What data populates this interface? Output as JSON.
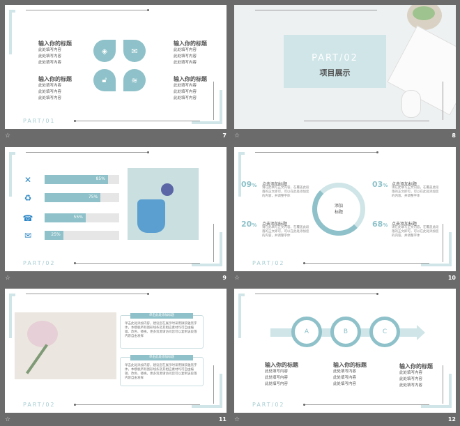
{
  "slides": {
    "s7": {
      "part": "PART/01",
      "num": "7",
      "left": [
        {
          "title": "输入你的标题",
          "lines": [
            "此处填写内容",
            "此处填写内容",
            "此处填写内容"
          ]
        },
        {
          "title": "输入你的标题",
          "lines": [
            "此处填写内容",
            "此处填写内容",
            "此处填写内容"
          ]
        }
      ],
      "right": [
        {
          "title": "输入你的标题",
          "lines": [
            "此处填写内容",
            "此处填写内容",
            "此处填写内容"
          ]
        },
        {
          "title": "输入你的标题",
          "lines": [
            "此处填写内容",
            "此处填写内容",
            "此处填写内容"
          ]
        }
      ]
    },
    "s8": {
      "part": "PART/02",
      "title": "项目展示",
      "num": "8"
    },
    "s9": {
      "part": "PART/02",
      "num": "9",
      "bars": [
        {
          "label": "85%",
          "value": 85
        },
        {
          "label": "75%",
          "value": 75
        },
        {
          "label": "55%",
          "value": 55
        },
        {
          "label": "25%",
          "value": 25
        }
      ]
    },
    "s10": {
      "part": "PART/02",
      "num": "10",
      "center": [
        "添加",
        "标题"
      ],
      "items": [
        {
          "pct": "09",
          "unit": "%",
          "title": "点击添加标题",
          "text": "请在此填写正文内容，在覆盖此段落的正文即可，可以在此处添加您的内容，并调整字体"
        },
        {
          "pct": "03",
          "unit": "%",
          "title": "点击添加标题",
          "text": "请在此填写正文内容，在覆盖此段落的正文即可，可以在此处添加您的内容，并调整字体"
        },
        {
          "pct": "20",
          "unit": "%",
          "title": "点击添加标题",
          "text": "请在此填写正文内容，在覆盖此段落的正文即可，可以在此处添加您的内容，并调整字体"
        },
        {
          "pct": "68",
          "unit": "%",
          "title": "点击添加标题",
          "text": "请在此填写正文内容，在覆盖此段落的正文即可，可以在此处添加您的内容，并调整字体"
        }
      ]
    },
    "s11": {
      "part": "PART/02",
      "num": "11",
      "boxes": [
        {
          "head": "单击此处添加标题",
          "text": "单击此处添加内容，建议您在展示时采用微软雅黑字体，本模板所有图形线条及其相应素材均可自由编辑、改色、替换。更多资源请访问您可以复制该段落内容自由发挥"
        },
        {
          "head": "单击此处添加标题",
          "text": "单击此处添加内容，建议您在展示时采用微软雅黑字体，本模板所有图形线条及其相应素材均可自由编辑、改色、替换。更多资源请访问您可以复制该段落内容自由发挥"
        }
      ]
    },
    "s12": {
      "part": "PART/02",
      "num": "12",
      "rings": [
        "A",
        "B",
        "C"
      ],
      "cols": [
        {
          "title": "输入你的标题",
          "lines": [
            "此处填写内容",
            "此处填写内容",
            "此处填写内容"
          ]
        },
        {
          "title": "输入你的标题",
          "lines": [
            "此处填写内容",
            "此处填写内容",
            "此处填写内容"
          ]
        },
        {
          "title": "输入你的标题",
          "lines": [
            "此处填写内容",
            "此处填写内容",
            "此处填写内容"
          ]
        }
      ]
    }
  },
  "footer_icon": "star-icon",
  "accent": "#8ec1c9"
}
